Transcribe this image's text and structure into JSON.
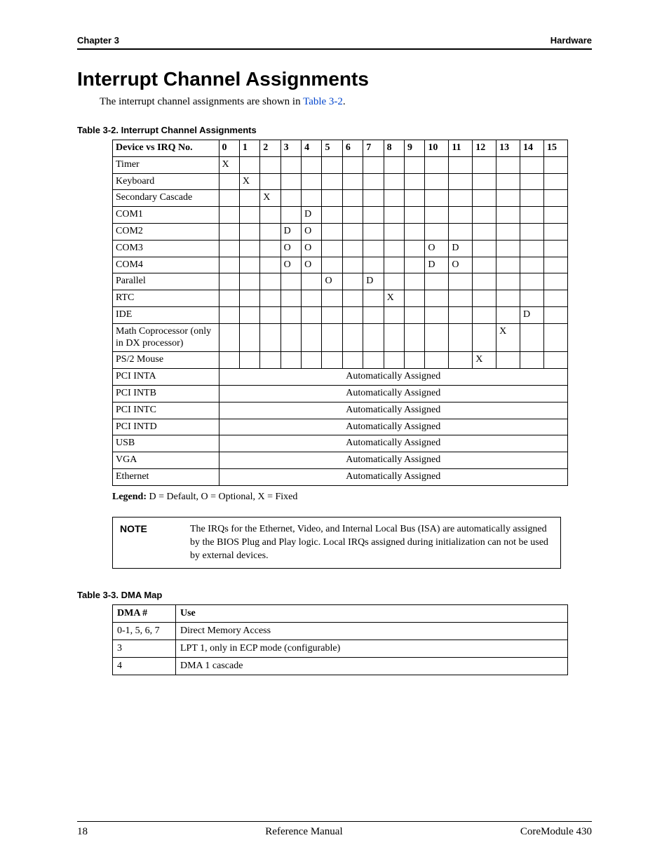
{
  "header": {
    "left": "Chapter 3",
    "right": "Hardware"
  },
  "title": "Interrupt Channel Assignments",
  "intro": {
    "prefix": "The interrupt channel assignments are shown in ",
    "link": "Table 3-2",
    "suffix": "."
  },
  "table32": {
    "caption": "Table 3-2.   Interrupt Channel Assignments",
    "head": [
      "Device vs IRQ No.",
      "0",
      "1",
      "2",
      "3",
      "4",
      "5",
      "6",
      "7",
      "8",
      "9",
      "10",
      "11",
      "12",
      "13",
      "14",
      "15"
    ],
    "rows": [
      {
        "device": "Timer",
        "cells": [
          "X",
          "",
          "",
          "",
          "",
          "",
          "",
          "",
          "",
          "",
          "",
          "",
          "",
          "",
          "",
          ""
        ]
      },
      {
        "device": "Keyboard",
        "cells": [
          "",
          "X",
          "",
          "",
          "",
          "",
          "",
          "",
          "",
          "",
          "",
          "",
          "",
          "",
          "",
          ""
        ]
      },
      {
        "device": "Secondary Cascade",
        "cells": [
          "",
          "",
          "X",
          "",
          "",
          "",
          "",
          "",
          "",
          "",
          "",
          "",
          "",
          "",
          "",
          ""
        ]
      },
      {
        "device": "COM1",
        "cells": [
          "",
          "",
          "",
          "",
          "D",
          "",
          "",
          "",
          "",
          "",
          "",
          "",
          "",
          "",
          "",
          ""
        ]
      },
      {
        "device": "COM2",
        "cells": [
          "",
          "",
          "",
          "D",
          "O",
          "",
          "",
          "",
          "",
          "",
          "",
          "",
          "",
          "",
          "",
          ""
        ]
      },
      {
        "device": "COM3",
        "cells": [
          "",
          "",
          "",
          "O",
          "O",
          "",
          "",
          "",
          "",
          "",
          "O",
          "D",
          "",
          "",
          "",
          ""
        ]
      },
      {
        "device": "COM4",
        "cells": [
          "",
          "",
          "",
          "O",
          "O",
          "",
          "",
          "",
          "",
          "",
          "D",
          "O",
          "",
          "",
          "",
          ""
        ]
      },
      {
        "device": "Parallel",
        "cells": [
          "",
          "",
          "",
          "",
          "",
          "O",
          "",
          "D",
          "",
          "",
          "",
          "",
          "",
          "",
          "",
          ""
        ]
      },
      {
        "device": "RTC",
        "cells": [
          "",
          "",
          "",
          "",
          "",
          "",
          "",
          "",
          "X",
          "",
          "",
          "",
          "",
          "",
          "",
          ""
        ]
      },
      {
        "device": "IDE",
        "cells": [
          "",
          "",
          "",
          "",
          "",
          "",
          "",
          "",
          "",
          "",
          "",
          "",
          "",
          "",
          "D",
          ""
        ]
      },
      {
        "device": "Math Coprocessor (only in DX processor)",
        "cells": [
          "",
          "",
          "",
          "",
          "",
          "",
          "",
          "",
          "",
          "",
          "",
          "",
          "",
          "X",
          "",
          ""
        ]
      },
      {
        "device": "PS/2 Mouse",
        "cells": [
          "",
          "",
          "",
          "",
          "",
          "",
          "",
          "",
          "",
          "",
          "",
          "",
          "X",
          "",
          "",
          ""
        ]
      },
      {
        "device": "PCI INTA",
        "auto": "Automatically Assigned"
      },
      {
        "device": "PCI INTB",
        "auto": "Automatically Assigned"
      },
      {
        "device": "PCI INTC",
        "auto": "Automatically Assigned"
      },
      {
        "device": "PCI INTD",
        "auto": "Automatically Assigned"
      },
      {
        "device": "USB",
        "auto": "Automatically Assigned"
      },
      {
        "device": "VGA",
        "auto": "Automatically Assigned"
      },
      {
        "device": "Ethernet",
        "auto": "Automatically Assigned"
      }
    ],
    "legend_label": "Legend:",
    "legend_text": " D = Default, O = Optional, X = Fixed"
  },
  "note": {
    "label": "NOTE",
    "body": "The IRQs for the Ethernet, Video, and Internal Local Bus (ISA) are automatically assigned by the BIOS Plug and Play logic. Local IRQs assigned during initialization can not be used by external devices."
  },
  "table33": {
    "caption": "Table 3-3.   DMA Map",
    "head": [
      "DMA #",
      "Use"
    ],
    "rows": [
      {
        "dma": "0-1, 5, 6, 7",
        "use": "Direct Memory Access"
      },
      {
        "dma": "3",
        "use": "LPT 1, only in ECP mode (configurable)"
      },
      {
        "dma": "4",
        "use": "DMA 1 cascade"
      }
    ]
  },
  "footer": {
    "page": "18",
    "center": "Reference Manual",
    "right": "CoreModule 430"
  }
}
